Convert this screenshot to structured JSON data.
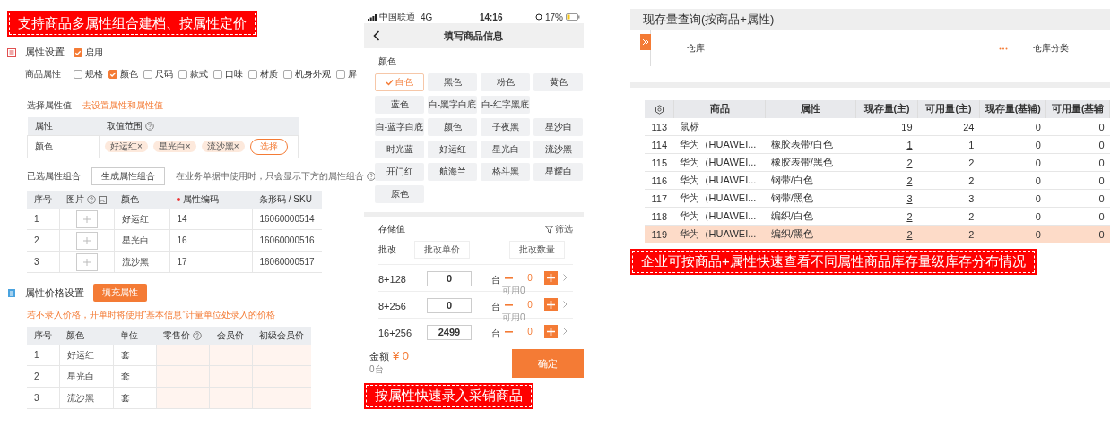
{
  "left": {
    "banner": "支持商品多属性组合建档、按属性定价",
    "attr_settings": {
      "title": "属性设置",
      "enable": {
        "label": "启用",
        "checked": true
      },
      "attr_label": "商品属性",
      "attributes": [
        {
          "label": "规格",
          "checked": false
        },
        {
          "label": "颜色",
          "checked": true
        },
        {
          "label": "尺码",
          "checked": false
        },
        {
          "label": "款式",
          "checked": false
        },
        {
          "label": "口味",
          "checked": false
        },
        {
          "label": "材质",
          "checked": false
        },
        {
          "label": "机身外观",
          "checked": false
        },
        {
          "label": "屏",
          "checked": false
        }
      ]
    },
    "select_values": {
      "label": "选择属性值",
      "link": "去设置属性和属性值",
      "columns": [
        "属性",
        "取值范围"
      ],
      "row": {
        "name": "颜色",
        "tags": [
          "好运红×",
          "星光白×",
          "流沙黑×"
        ],
        "button": "选择"
      }
    },
    "combos": {
      "label": "已选属性组合",
      "button": "生成属性组合",
      "hint": "在业务单据中使用时，只会显示下方的属性组合",
      "columns": [
        {
          "label": "序号",
          "required": false
        },
        {
          "label": "图片",
          "required": false
        },
        {
          "label": "颜色",
          "required": false
        },
        {
          "label": "属性编码",
          "required": true
        },
        {
          "label": "条形码 / SKU",
          "required": false
        }
      ],
      "rows": [
        [
          "1",
          "",
          "好运红",
          "14",
          "16060000514"
        ],
        [
          "2",
          "",
          "星光白",
          "16",
          "16060000516"
        ],
        [
          "3",
          "",
          "流沙黑",
          "17",
          "16060000517"
        ]
      ]
    },
    "price": {
      "title": "属性价格设置",
      "button": "填充属性",
      "warning": "若不录入价格，开单时将使用“基本信息”计量单位处录入的价格",
      "columns": [
        "序号",
        "颜色",
        "单位",
        "零售价",
        "会员价",
        "初级会员价"
      ],
      "rows": [
        [
          "1",
          "好运红",
          "套"
        ],
        [
          "2",
          "星光白",
          "套"
        ],
        [
          "3",
          "流沙黑",
          "套"
        ]
      ]
    }
  },
  "middle": {
    "status": {
      "carrier": "中国联通",
      "network": "4G",
      "time": "14:16",
      "battery": "17%"
    },
    "title": "填写商品信息",
    "color_label": "颜色",
    "color_rows": [
      [
        {
          "label": "白色",
          "selected": true
        },
        {
          "label": "黑色",
          "selected": false
        },
        {
          "label": "粉色",
          "selected": false
        },
        {
          "label": "黄色",
          "selected": false
        }
      ],
      [
        {
          "label": "蓝色",
          "selected": false
        },
        {
          "label": "白-黑字白底",
          "selected": false
        },
        {
          "label": "白-红字黑底",
          "selected": false
        }
      ],
      [
        {
          "label": "白-蓝字白底",
          "selected": false
        },
        {
          "label": "颜色",
          "selected": false
        },
        {
          "label": "子夜黑",
          "selected": false
        },
        {
          "label": "星沙白",
          "selected": false
        }
      ],
      [
        {
          "label": "时光蓝",
          "selected": false
        },
        {
          "label": "好运红",
          "selected": false
        },
        {
          "label": "星光白",
          "selected": false
        },
        {
          "label": "流沙黑",
          "selected": false
        }
      ],
      [
        {
          "label": "开门红",
          "selected": false
        },
        {
          "label": "航海兰",
          "selected": false
        },
        {
          "label": "格斗黑",
          "selected": false
        },
        {
          "label": "星耀白",
          "selected": false
        }
      ],
      [
        {
          "label": "原色",
          "selected": false
        }
      ]
    ],
    "storage_label": "存储值",
    "filter": "筛选",
    "batch_label": "批改",
    "batch_buttons": [
      "批改单价",
      "批改数量"
    ],
    "variants": [
      {
        "name": "8+128",
        "price": "0",
        "unit": "台",
        "qty": "0",
        "available": "可用0"
      },
      {
        "name": "8+256",
        "price": "0",
        "unit": "台",
        "qty": "0",
        "available": "可用0"
      },
      {
        "name": "16+256",
        "price": "2499",
        "unit": "台",
        "qty": "0"
      }
    ],
    "footer": {
      "total_label": "金额",
      "total": "¥ 0",
      "count": "0台",
      "confirm": "确定"
    },
    "banner": "按属性快速录入采销商品"
  },
  "right": {
    "title": "现存量查询(按商品+属性)",
    "filters": [
      "仓库",
      "仓库分类"
    ],
    "columns": [
      "商品",
      "属性",
      "现存量(主)",
      "可用量(主)",
      "现存量(基辅)",
      "可用量(基辅"
    ],
    "rows": [
      {
        "no": "113",
        "product": "鼠标",
        "attribute": "",
        "on_hand": "19",
        "available": "24",
        "on_hand_aux": "0",
        "available_aux": "0",
        "selected": false
      },
      {
        "no": "114",
        "product": "华为（HUAWEI...",
        "attribute": "橡胶表带/白色",
        "on_hand": "1",
        "available": "1",
        "on_hand_aux": "0",
        "available_aux": "0",
        "selected": false
      },
      {
        "no": "115",
        "product": "华为（HUAWEI...",
        "attribute": "橡胶表带/黑色",
        "on_hand": "2",
        "available": "2",
        "on_hand_aux": "0",
        "available_aux": "0",
        "selected": false
      },
      {
        "no": "116",
        "product": "华为（HUAWEI...",
        "attribute": "钢带/白色",
        "on_hand": "2",
        "available": "2",
        "on_hand_aux": "0",
        "available_aux": "0",
        "selected": false
      },
      {
        "no": "117",
        "product": "华为（HUAWEI...",
        "attribute": "钢带/黑色",
        "on_hand": "3",
        "available": "3",
        "on_hand_aux": "0",
        "available_aux": "0",
        "selected": false
      },
      {
        "no": "118",
        "product": "华为（HUAWEI...",
        "attribute": "编织/白色",
        "on_hand": "2",
        "available": "2",
        "on_hand_aux": "0",
        "available_aux": "0",
        "selected": false
      },
      {
        "no": "119",
        "product": "华为（HUAWEI...",
        "attribute": "编织/黑色",
        "on_hand": "2",
        "available": "2",
        "on_hand_aux": "0",
        "available_aux": "0",
        "selected": true
      }
    ],
    "banner": "企业可按商品+属性快速查看不同属性商品库存量级库存分布情况"
  }
}
